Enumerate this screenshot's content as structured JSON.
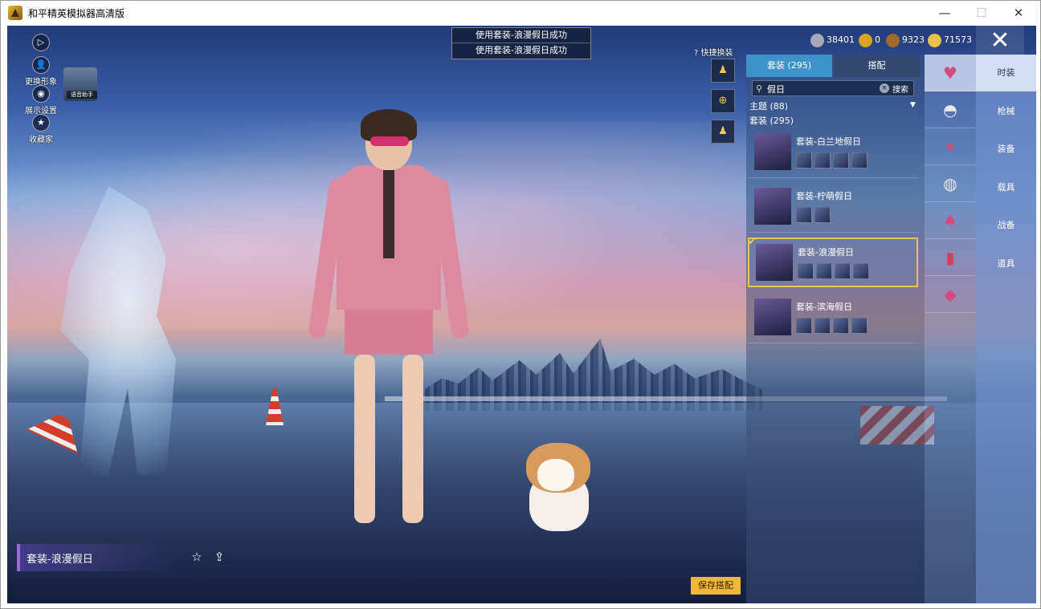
{
  "window": {
    "title": "和平精英模拟器高清版",
    "min_glyph": "—",
    "max_glyph": "☐",
    "close_glyph": "✕"
  },
  "game_close_glyph": "✕",
  "left_tools": {
    "items": [
      {
        "label": "",
        "icon": "play-icon",
        "glyph": "▷"
      },
      {
        "label": "更换形象",
        "icon": "avatar-icon",
        "glyph": "👤"
      },
      {
        "label": "展示设置",
        "icon": "eye-icon",
        "glyph": "◉"
      },
      {
        "label": "收藏家",
        "icon": "collector-icon",
        "glyph": "★"
      }
    ],
    "voice_label": "语音助手"
  },
  "toasts": [
    "使用套装-浪漫假日成功",
    "使用套装-浪漫假日成功"
  ],
  "currencies": [
    {
      "icon": "coin-silver-icon",
      "value": "38401",
      "color": "#a8a8b8"
    },
    {
      "icon": "coin-gold-icon",
      "value": "0",
      "color": "#d9a425"
    },
    {
      "icon": "coin-bronze-icon",
      "value": "9323",
      "color": "#a26a2a"
    },
    {
      "icon": "coin-star-icon",
      "value": "71573",
      "color": "#e8c04a"
    }
  ],
  "quick_change": {
    "label": "快捷换装"
  },
  "panel": {
    "tabs": [
      "套装 (295)",
      "搭配"
    ],
    "search": {
      "value": "假日",
      "button": "搜索",
      "clear_glyph": "×",
      "icon_glyph": "⚲"
    },
    "theme_header": "主题 (88)",
    "suit_header": "套装 (295)",
    "dropdown_glyph": "▼",
    "check_glyph": "✔",
    "items": [
      {
        "name": "套装-白兰地假日",
        "slots": 4,
        "selected": false
      },
      {
        "name": "套装-柠萌假日",
        "slots": 2,
        "selected": false
      },
      {
        "name": "套装-浪漫假日",
        "slots": 4,
        "selected": true
      },
      {
        "name": "套装-滨海假日",
        "slots": 4,
        "selected": false
      }
    ]
  },
  "categories": [
    "outfit-icon",
    "hat-icon",
    "weapon-skin-icon",
    "mask-icon",
    "top-icon",
    "pants-icon",
    "shoes-icon"
  ],
  "menu": [
    "时装",
    "枪械",
    "装备",
    "载具",
    "战备",
    "道具"
  ],
  "bottom": {
    "outfit_name": "套装-浪漫假日",
    "save_button": "保存搭配"
  },
  "colors": {
    "accent": "#3f93c9",
    "selected_border": "#e8c45a",
    "save_button": "#f0b838"
  }
}
